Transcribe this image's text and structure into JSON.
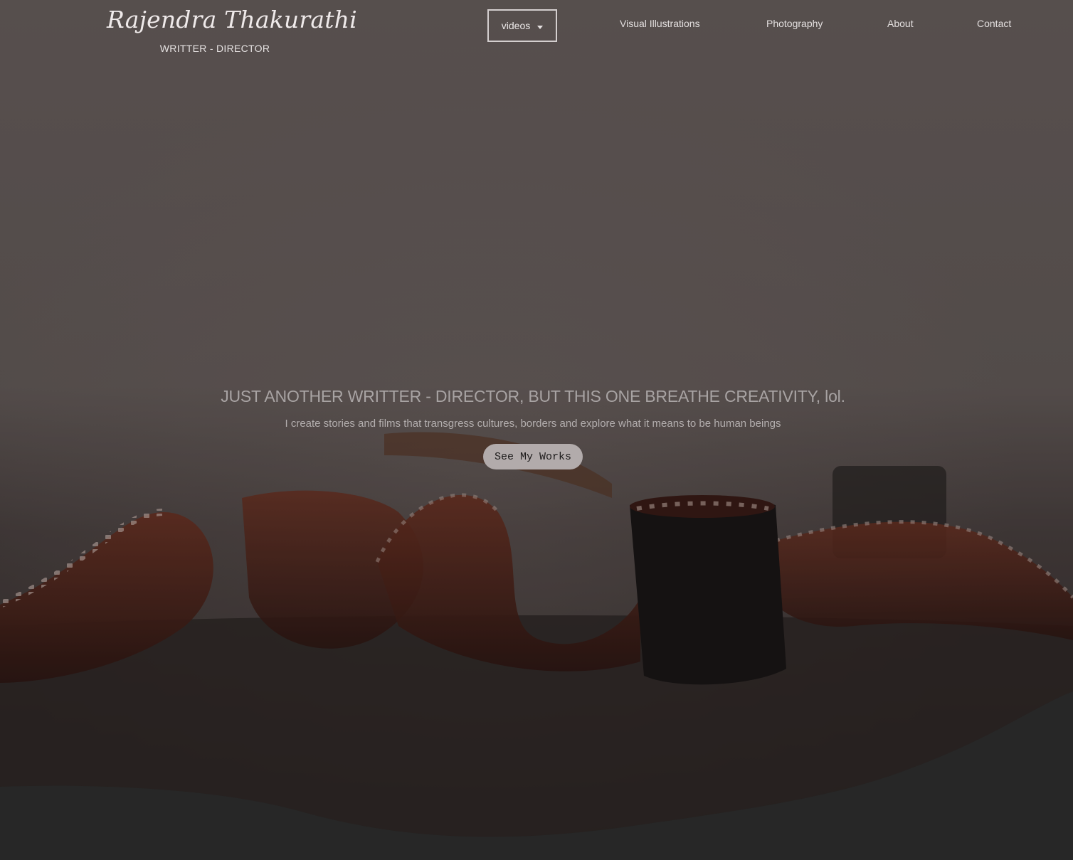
{
  "header": {
    "brand_name": "Rajendra Thakurathi",
    "brand_role": "WRITTER - DIRECTOR",
    "nav": {
      "dropdown_label": "videos",
      "items": [
        {
          "label": "Visual Illustrations"
        },
        {
          "label": "Photography"
        },
        {
          "label": "About"
        },
        {
          "label": "Contact"
        }
      ]
    }
  },
  "hero": {
    "headline": "JUST ANOTHER WRITTER - DIRECTOR, BUT THIS ONE BREATHE CREATIVITY, lol.",
    "subline": "I create stories and films that transgress cultures, borders and explore what it means to be human beings",
    "cta_label": "See My Works",
    "background_image": "film-strip-reels-photo"
  },
  "colors": {
    "overlay": "#6a6261",
    "film": "#5a2a20",
    "wave": "#272727",
    "cta_bg": "#b2abab"
  }
}
